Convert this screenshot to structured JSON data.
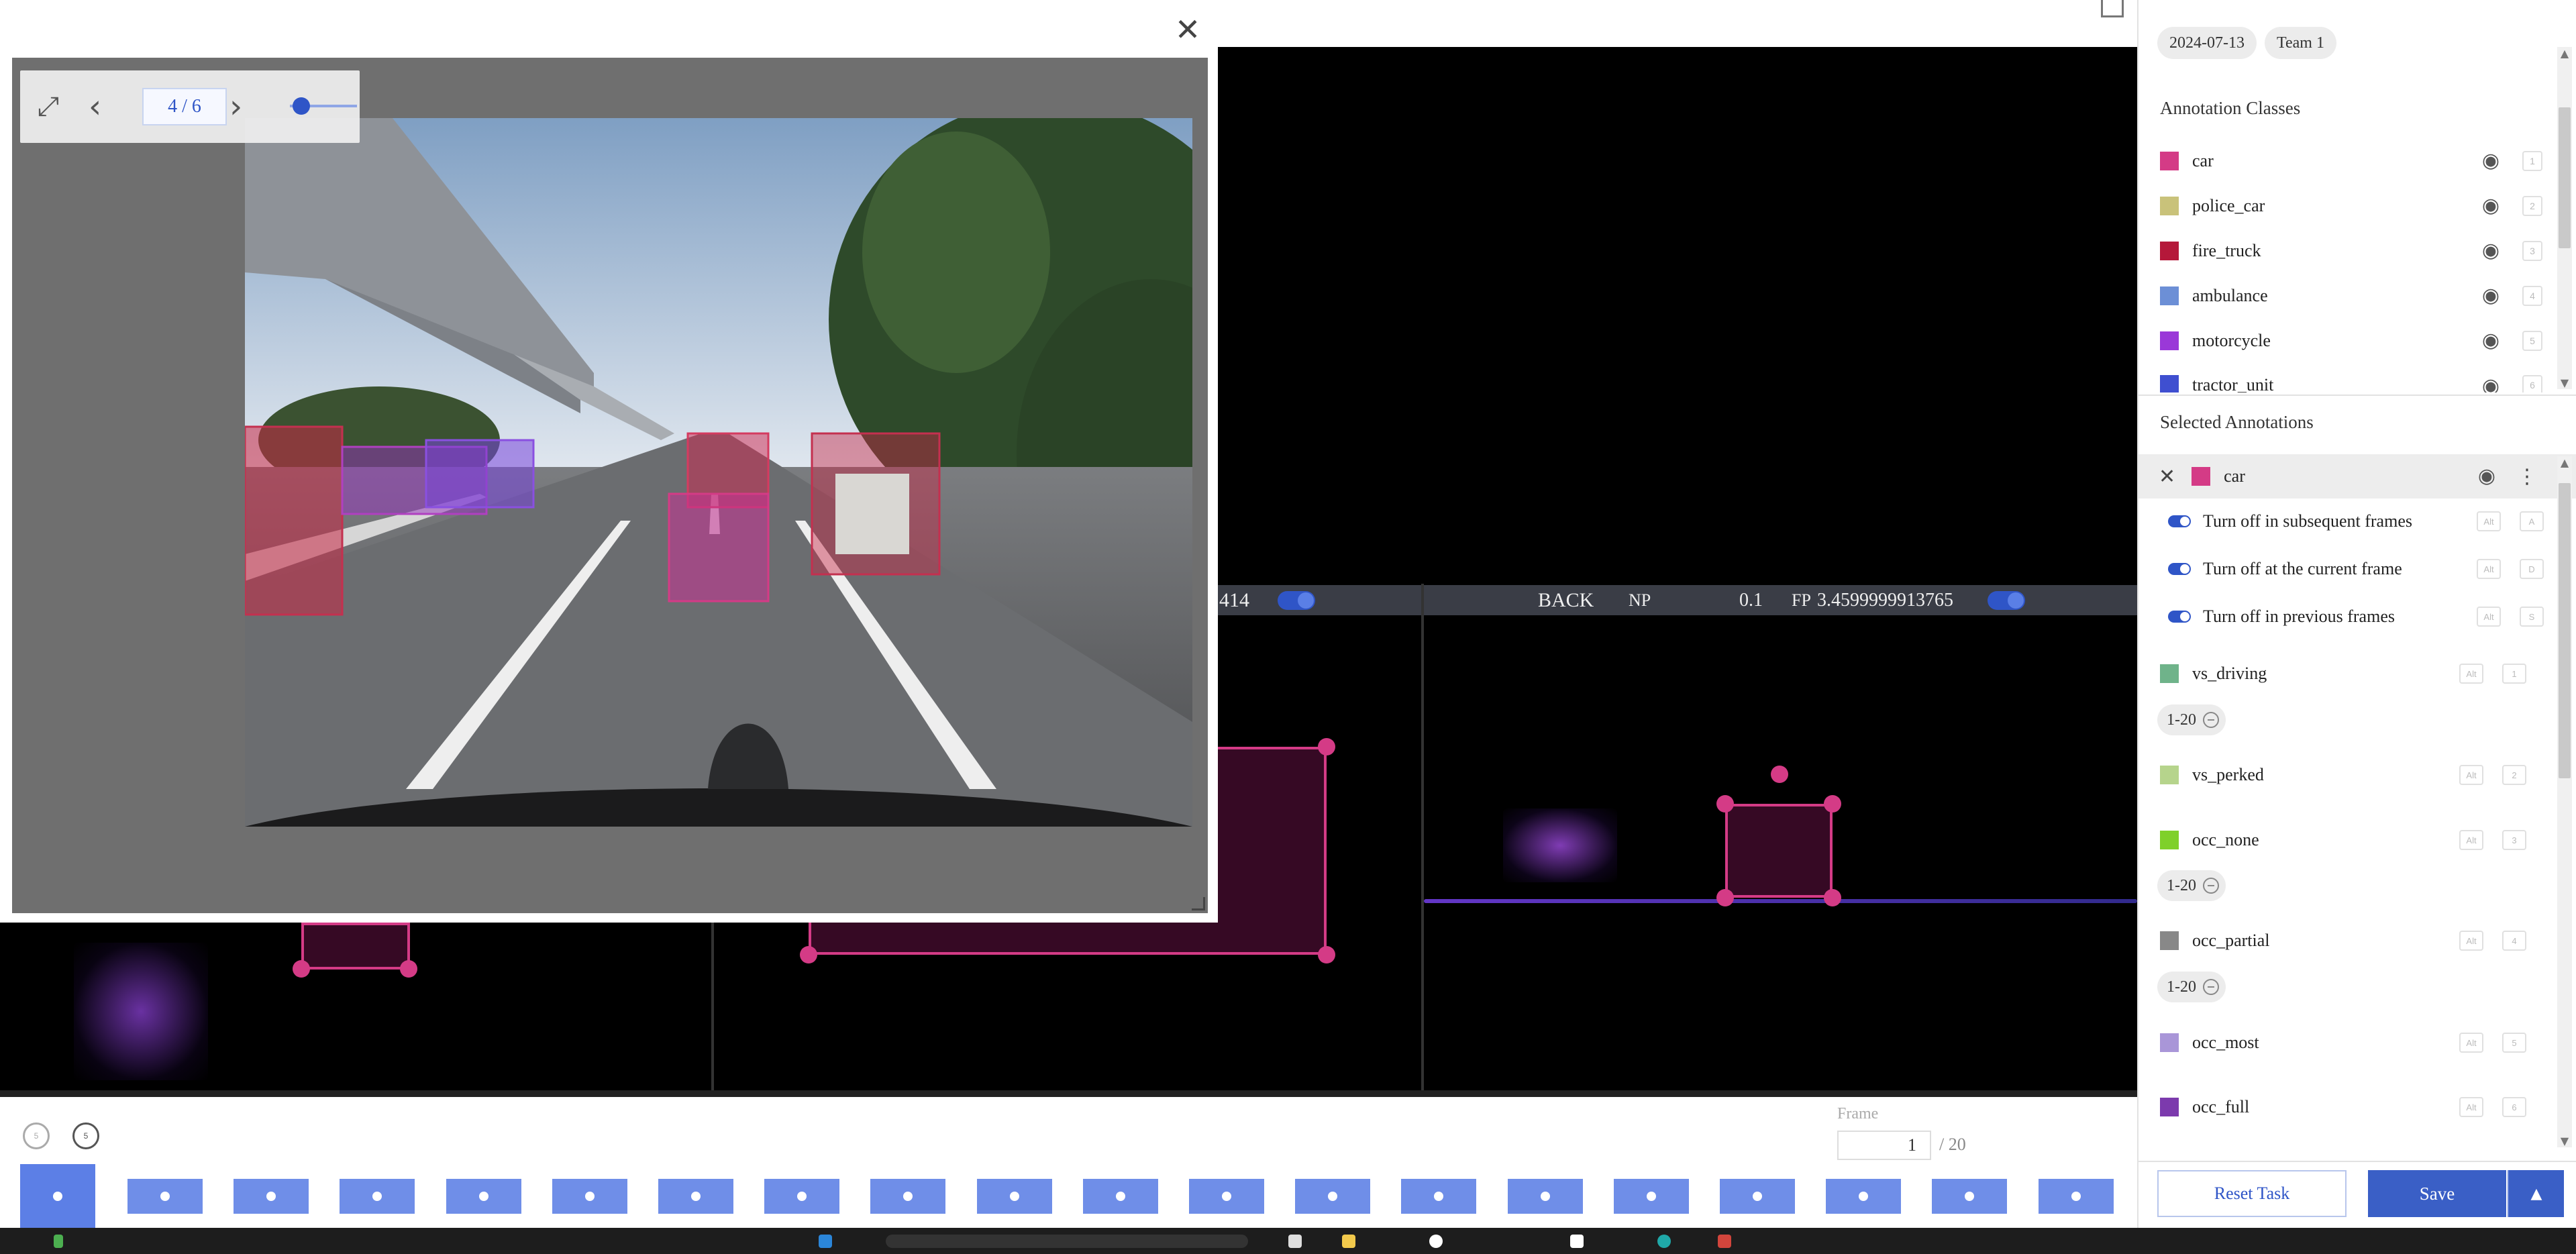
{
  "viewer": {
    "page": "4 / 6",
    "zoom_level": 0.1,
    "icons": {
      "fullscreen": "expand-icon",
      "prev": "chevron-left-icon",
      "next": "chevron-right-icon",
      "close": "close-icon"
    },
    "close_glyph": "✕",
    "prev_glyph": "‹",
    "next_glyph": "›",
    "fullscreen_glyph": "⤢"
  },
  "panels": {
    "left_header_value": "414",
    "back": {
      "name": "BACK",
      "np_label": "NP",
      "np_value": "0.1",
      "fp_label": "FP",
      "fp_value": "3.4599999913765"
    }
  },
  "sidebar": {
    "tags": [
      "2024-07-13",
      "Team 1"
    ],
    "annotation_classes_title": "Annotation Classes",
    "classes": [
      {
        "label": "car",
        "color": "#d43b86",
        "hotkey": "1"
      },
      {
        "label": "police_car",
        "color": "#c9c27a",
        "hotkey": "2"
      },
      {
        "label": "fire_truck",
        "color": "#b5183a",
        "hotkey": "3"
      },
      {
        "label": "ambulance",
        "color": "#6c8fd6",
        "hotkey": "4"
      },
      {
        "label": "motorcycle",
        "color": "#9a38d8",
        "hotkey": "5"
      },
      {
        "label": "tractor_unit",
        "color": "#3f4fd0",
        "hotkey": "6"
      }
    ],
    "selected_title": "Selected Annotations",
    "selected": {
      "label": "car",
      "color": "#d43b86"
    },
    "options": [
      {
        "label": "Turn off in subsequent frames",
        "keys": [
          "Alt",
          "A"
        ]
      },
      {
        "label": "Turn off at the current frame",
        "keys": [
          "Alt",
          "D"
        ]
      },
      {
        "label": "Turn off in previous frames",
        "keys": [
          "Alt",
          "S"
        ]
      }
    ],
    "attributes": [
      {
        "label": "vs_driving",
        "color": "#6fb38a",
        "keys": [
          "Alt",
          "1"
        ],
        "range": "1-20"
      },
      {
        "label": "vs_perked",
        "color": "#b6d48c",
        "keys": [
          "Alt",
          "2"
        ],
        "range": ""
      },
      {
        "label": "occ_none",
        "color": "#7fd02a",
        "keys": [
          "Alt",
          "3"
        ],
        "range": "1-20"
      },
      {
        "label": "occ_partial",
        "color": "#888888",
        "keys": [
          "Alt",
          "4"
        ],
        "range": "1-20"
      },
      {
        "label": "occ_most",
        "color": "#a996d8",
        "keys": [
          "Alt",
          "5"
        ],
        "range": ""
      },
      {
        "label": "occ_full",
        "color": "#7c3aad",
        "keys": [
          "Alt",
          "6"
        ],
        "range": ""
      }
    ],
    "reset_label": "Reset Task",
    "save_label": "Save",
    "caret_glyph": "▲"
  },
  "controls": {
    "undo_label": "5",
    "redo_label": "5",
    "frame_label": "Frame",
    "frame_value": "1",
    "frame_total": "/ 20"
  },
  "timeline": {
    "frame_count": 20,
    "active_index": 0
  },
  "colors": {
    "accent": "#2f55c7",
    "annotation": "#d43b86",
    "frame": "#6f8ee8"
  }
}
